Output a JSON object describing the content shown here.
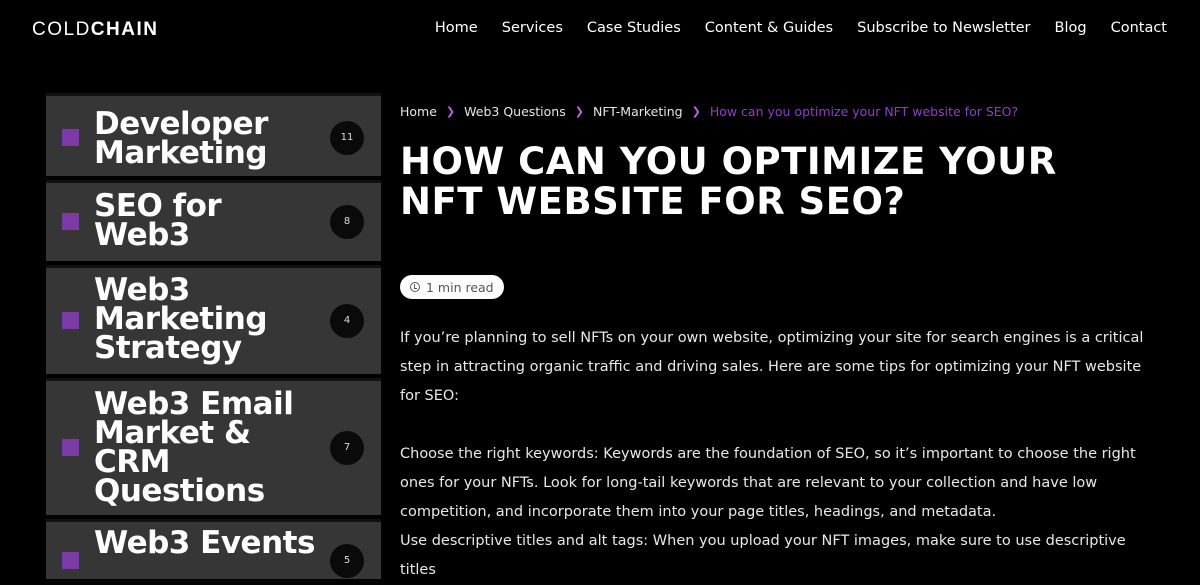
{
  "header": {
    "logo_light": "COLD",
    "logo_bold": "CHAIN",
    "nav": [
      "Home",
      "Services",
      "Case Studies",
      "Content & Guides",
      "Subscribe to Newsletter",
      "Blog",
      "Contact"
    ]
  },
  "sidebar": {
    "categories": [
      {
        "label": "Developer Marketing",
        "count": "11"
      },
      {
        "label": "SEO for Web3",
        "count": "8"
      },
      {
        "label": "Web3 Marketing Strategy",
        "count": "4"
      },
      {
        "label": "Web3 Email Market & CRM Questions",
        "count": "7"
      },
      {
        "label": "Web3 Events",
        "count": "5"
      }
    ]
  },
  "breadcrumb": {
    "items": [
      "Home",
      "Web3 Questions",
      "NFT-Marketing"
    ],
    "current": "How can you optimize your NFT website for SEO?"
  },
  "article": {
    "title": "HOW CAN YOU OPTIMIZE YOUR NFT WEBSITE FOR SEO?",
    "read_time": "1 min read",
    "paragraphs": [
      "If you’re planning to sell NFTs on your own website, optimizing your site for search engines is a critical step in attracting organic traffic and driving sales. Here are some tips for optimizing your NFT website for SEO:",
      "Choose the right keywords: Keywords are the foundation of SEO, so it’s important to choose the right ones for your NFTs. Look for long-tail keywords that are relevant to your collection and have low competition, and incorporate them into your page titles, headings, and metadata.",
      "Use descriptive titles and alt tags: When you upload your NFT images, make sure to use descriptive titles"
    ]
  },
  "colors": {
    "background": "#000000",
    "accent": "#7b3aa6",
    "card": "#363636"
  }
}
